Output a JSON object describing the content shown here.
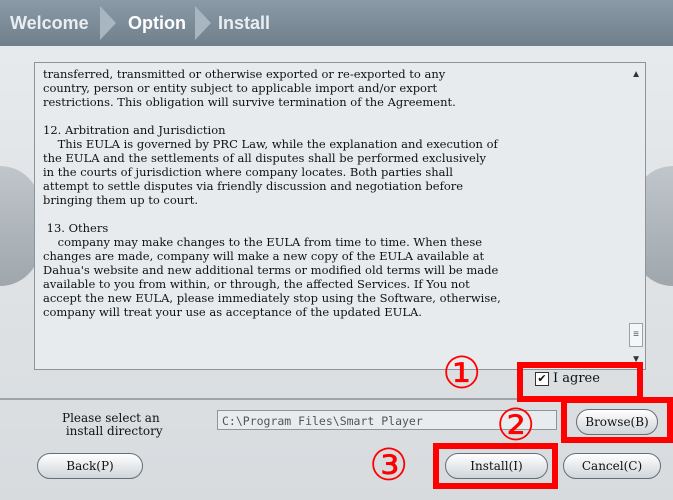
{
  "breadcrumb": {
    "step1": "Welcome",
    "step2": "Option",
    "step3": "Install"
  },
  "license": {
    "text": "transferred, transmitted or otherwise exported or re-exported to any\ncountry, person or entity subject to applicable import and/or export\nrestrictions. This obligation will survive termination of the Agreement.\n\n12. Arbitration and Jurisdiction\n    This EULA is governed by PRC Law, while the explanation and execution of\nthe EULA and the settlements of all disputes shall be performed exclusively\nin the courts of jurisdiction where company locates. Both parties shall\nattempt to settle disputes via friendly discussion and negotiation before\nbringing them up to court.\n\n 13. Others\n    company may make changes to the EULA from time to time. When these\nchanges are made, company will make a new copy of the EULA available at\nDahua's website and new additional terms or modified old terms will be made\navailable to you from within, or through, the affected Services. If You not\naccept the new EULA, please immediately stop using the Software, otherwise,\ncompany will treat your use as acceptance of the updated EULA."
  },
  "agree": {
    "label": "I agree",
    "checked": true
  },
  "directory": {
    "label": "Please select an\n install directory",
    "value": "C:\\Program Files\\Smart Player"
  },
  "buttons": {
    "browse": "Browse(B)",
    "back": "Back(P)",
    "install": "Install(I)",
    "cancel": "Cancel(C)"
  },
  "annotations": {
    "one": "①",
    "two": "②",
    "three": "③",
    "color": "#ff0000"
  }
}
